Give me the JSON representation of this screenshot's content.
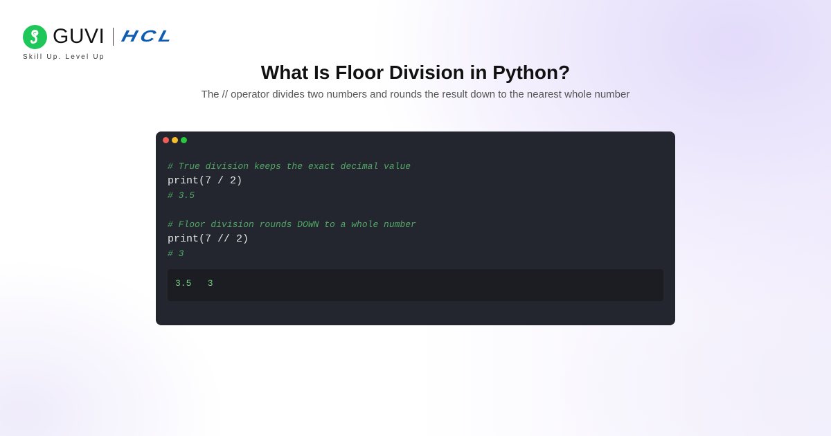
{
  "brand": {
    "name": "GUVI",
    "partner": "HCL",
    "tagline": "Skill Up. Level Up"
  },
  "title": "What Is Floor Division in Python?",
  "subtitle": "The // operator divides two numbers and rounds the result down to the nearest whole number",
  "code_window": {
    "window_controls": [
      "red-dot",
      "yellow-dot",
      "green-dot"
    ],
    "lines": [
      {
        "kind": "comment",
        "text": "# True division keeps the exact decimal value"
      },
      {
        "kind": "code",
        "text": "print(7 / 2)"
      },
      {
        "kind": "comment",
        "text": "# 3.5"
      },
      {
        "kind": "blank",
        "text": ""
      },
      {
        "kind": "comment",
        "text": "# Floor division rounds DOWN to a whole number"
      },
      {
        "kind": "code",
        "text": "print(7 // 2)"
      },
      {
        "kind": "comment",
        "text": "# 3"
      }
    ],
    "output": "3.5   3"
  },
  "colors": {
    "guvi_green": "#1fc65a",
    "hcl_blue": "#0e5db3",
    "code_background": "#23252f",
    "output_background": "#1b1d23",
    "comment_green": "#52a866",
    "output_green": "#72d07c"
  }
}
